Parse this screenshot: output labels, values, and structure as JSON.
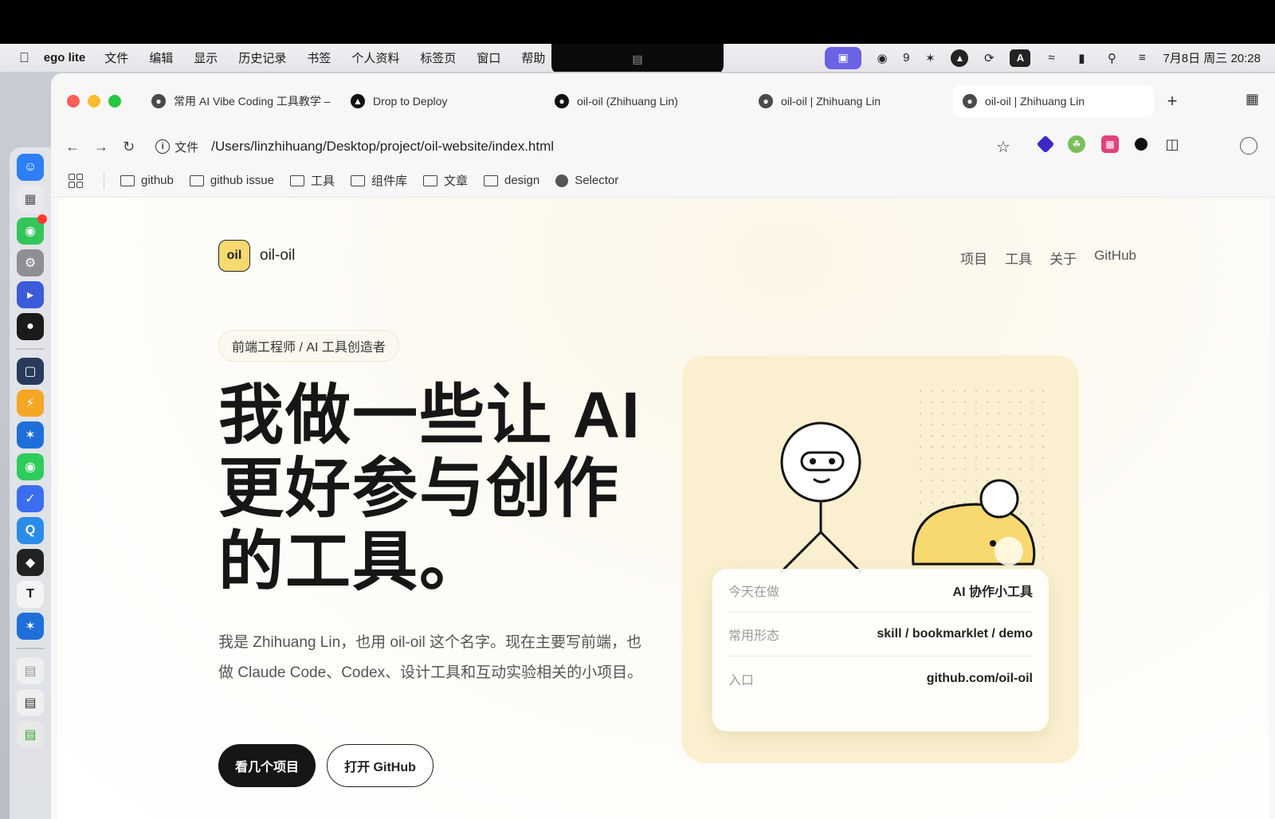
{
  "menubar": {
    "app_name": "ego lite",
    "items": [
      "文件",
      "编辑",
      "显示",
      "历史记录",
      "书签",
      "个人资料",
      "标签页",
      "窗口",
      "帮助"
    ],
    "wechat_count": "9",
    "input_method": "A",
    "datetime": "7月8日 周三 20:28"
  },
  "browser": {
    "tabs": [
      {
        "title": "常用 AI Vibe Coding 工具教学 –",
        "icon": "globe-icon"
      },
      {
        "title": "Drop to Deploy",
        "icon": "deploy-icon"
      },
      {
        "title": "oil-oil (Zhihuang Lin)",
        "icon": "github-icon"
      },
      {
        "title": "oil-oil | Zhihuang Lin",
        "icon": "globe-icon"
      },
      {
        "title": "oil-oil | Zhihuang Lin",
        "icon": "globe-icon",
        "active": true
      }
    ],
    "address": {
      "scheme_label": "文件",
      "url": "/Users/linzhihuang/Desktop/project/oil-website/index.html"
    },
    "bookmarks": [
      "github",
      "github issue",
      "工具",
      "组件库",
      "文章",
      "design",
      "Selector"
    ]
  },
  "site": {
    "logo_badge": "oil",
    "logo_text": "oil-oil",
    "nav": [
      "项目",
      "工具",
      "关于",
      "GitHub"
    ],
    "role": "前端工程师 / AI 工具创造者",
    "hero_lines": [
      "我做一些让 AI",
      "更好参与创作",
      "的工具。"
    ],
    "intro": "我是 Zhihuang Lin，也用 oil-oil 这个名字。现在主要写前端，也做 Claude Code、Codex、设计工具和互动实验相关的小项目。",
    "primary_button": "看几个项目",
    "secondary_button": "打开 GitHub",
    "info": [
      {
        "key": "今天在做",
        "value": "AI 协作小工具"
      },
      {
        "key": "常用形态",
        "value": "skill / bookmarklet / demo"
      },
      {
        "key": "入口",
        "value": "github.com/oil-oil"
      }
    ]
  },
  "colors": {
    "accent_yellow": "#f7d970",
    "card_bg": "#faf0cf",
    "dark_button": "#161616"
  }
}
